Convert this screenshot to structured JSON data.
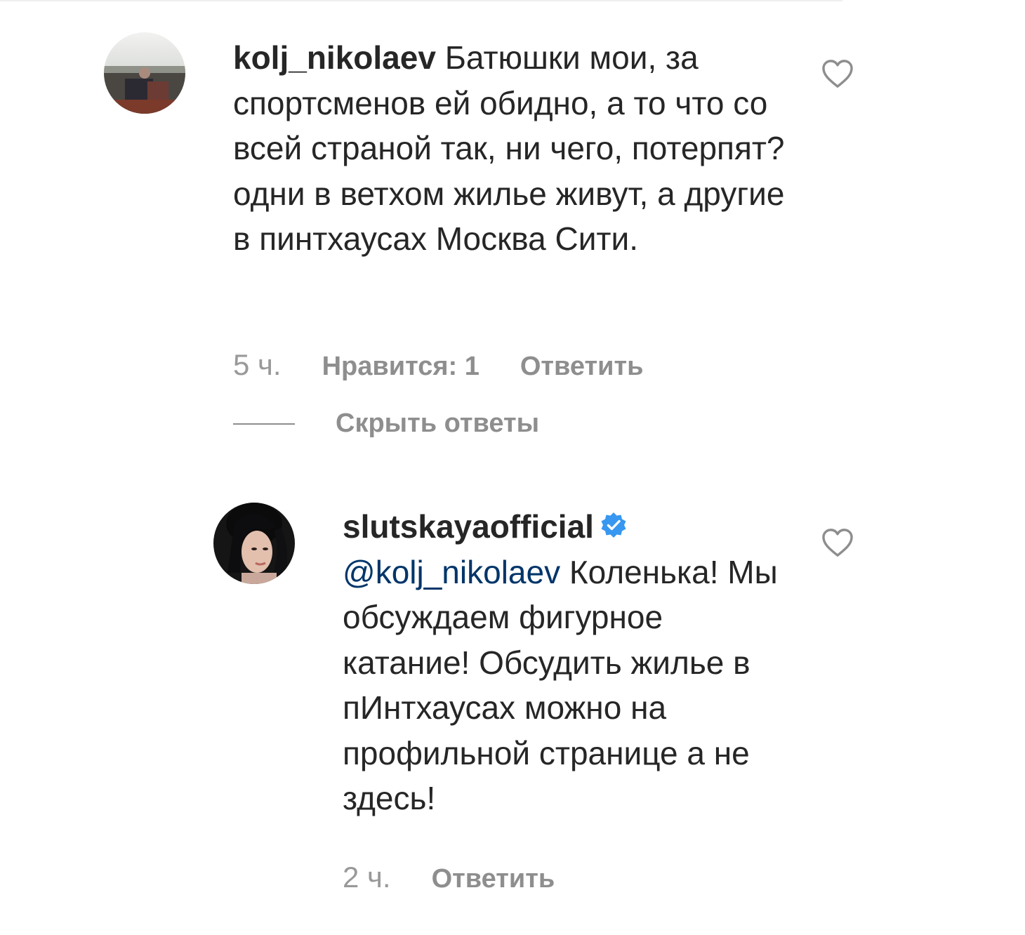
{
  "comments": [
    {
      "username": "kolj_nikolaev",
      "text": "Батюшки мои, за спортсменов ей обидно, а то что со всей страной так, ни чего, потерпят? одни в ветхом жилье живут, а другие в пинтхаусах Москва Сити.",
      "time": "5 ч.",
      "likes_label": "Нравится: 1",
      "reply_label": "Ответить",
      "hide_replies_label": "Скрыть ответы"
    }
  ],
  "replies": [
    {
      "username": "slutskayaofficial",
      "verified": true,
      "mention": "@kolj_nikolaev",
      "text": "Коленька! Мы обсуждаем фигурное катание! Обсудить жилье в пИнтхаусах можно на профильной странице а не здесь!",
      "time": "2 ч.",
      "reply_label": "Ответить"
    }
  ],
  "colors": {
    "text": "#262626",
    "muted": "#8e8e8e",
    "mention": "#003569",
    "verified_badge": "#3897f0"
  }
}
